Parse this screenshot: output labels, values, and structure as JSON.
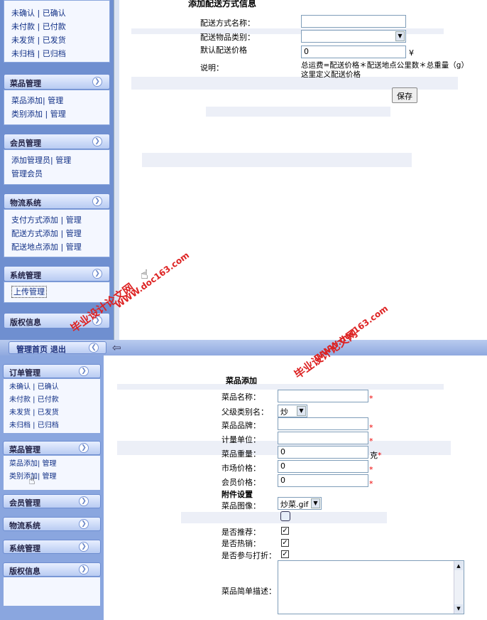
{
  "top_sidebar": {
    "order_links": [
      [
        "未确认",
        "已确认"
      ],
      [
        "未付款",
        "已付款"
      ],
      [
        "未发货",
        "已发货"
      ],
      [
        "未归档",
        "已归档"
      ]
    ],
    "panels": [
      {
        "title": "菜品管理",
        "links": [
          "菜品添加| 管理",
          "类别添加 | 管理"
        ]
      },
      {
        "title": "会员管理",
        "links": [
          "添加管理员| 管理",
          "管理会员"
        ]
      },
      {
        "title": "物流系统",
        "links": [
          "支付方式添加 | 管理",
          "配送方式添加 | 管理",
          "配送地点添加 | 管理"
        ]
      },
      {
        "title": "系统管理",
        "links": [
          "上传管理"
        ]
      },
      {
        "title": "版权信息",
        "links": []
      }
    ],
    "footer_links": "管理首页  退出"
  },
  "delivery_form": {
    "heading": "添加配送方式信息",
    "name_label": "配送方式名称：",
    "category_label": "配送物品类别：",
    "price_label": "默认配送价格",
    "price_value": "0",
    "price_unit": "¥",
    "note_label": "说明：",
    "note_line1": "总运费=配送价格＊配送地点公里数＊总重量（g）",
    "note_line2": "这里定义配送价格",
    "save": "保存"
  },
  "bottom_sidebar": {
    "order_title": "订单管理",
    "order_links": [
      [
        "未确认",
        "已确认"
      ],
      [
        "未付款",
        "已付款"
      ],
      [
        "未发货",
        "已发货"
      ],
      [
        "未归档",
        "已归档"
      ]
    ],
    "dish_title": "菜品管理",
    "dish_links": [
      "菜品添加| 管理",
      "类别添加| 管理"
    ],
    "collapsed": [
      "会员管理",
      "物流系统",
      "系统管理",
      "版权信息"
    ]
  },
  "dish_form": {
    "heading": "菜品添加",
    "name_label": "菜品名称：",
    "parent_label": "父级类别名：",
    "parent_value": "炒菜",
    "brand_label": "菜品品牌：",
    "unit_label": "计量单位：",
    "weight_label": "菜品重量：",
    "weight_value": "0",
    "weight_unit": "克",
    "market_label": "市场价格：",
    "market_value": "0",
    "member_label": "会员价格：",
    "member_value": "0",
    "attach_heading": "附件设置",
    "image_label": "菜品图像：",
    "image_value": "炒菜.gif",
    "recommend_label": "是否推荐：",
    "hot_label": "是否热销：",
    "discount_label": "是否参与打折：",
    "desc_label": "菜品简单描述："
  },
  "watermarks": {
    "site": "WWW.doc163.com",
    "text": "毕业设计论文网"
  }
}
